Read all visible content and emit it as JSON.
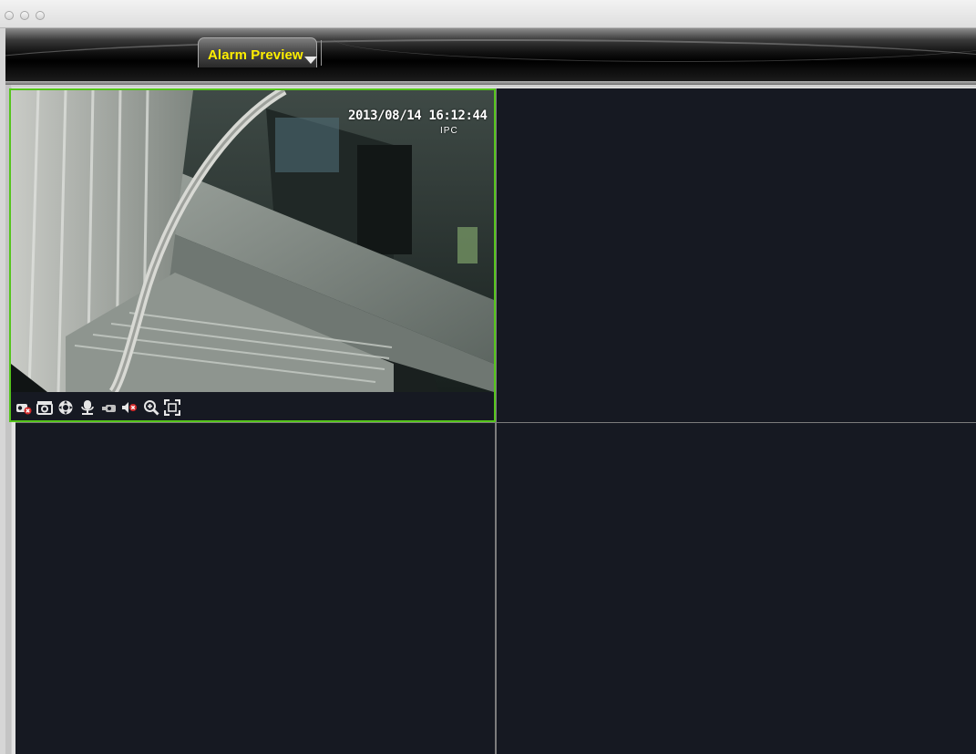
{
  "window": {
    "traffic_lights": [
      "close",
      "minimize",
      "zoom"
    ]
  },
  "tabs": [
    {
      "label": "Alarm Preview",
      "active": true,
      "color": "#ffef00"
    }
  ],
  "colors": {
    "active_pane_border": "#55c51b",
    "pane_background": "#161922",
    "tab_text": "#ffef00"
  },
  "panes": [
    {
      "id": 1,
      "active": true,
      "osd_time": "2013/08/14 16:12:44",
      "osd_label": "IPC",
      "controls": [
        {
          "icon": "stop-record-icon"
        },
        {
          "icon": "snapshot-icon"
        },
        {
          "icon": "ptz-icon"
        },
        {
          "icon": "talk-microphone-icon"
        },
        {
          "icon": "record-icon"
        },
        {
          "icon": "mute-audio-icon"
        },
        {
          "icon": "zoom-in-icon"
        },
        {
          "icon": "fullscreen-icon"
        }
      ]
    },
    {
      "id": 2,
      "active": false
    },
    {
      "id": 3,
      "active": false
    },
    {
      "id": 4,
      "active": false
    }
  ]
}
